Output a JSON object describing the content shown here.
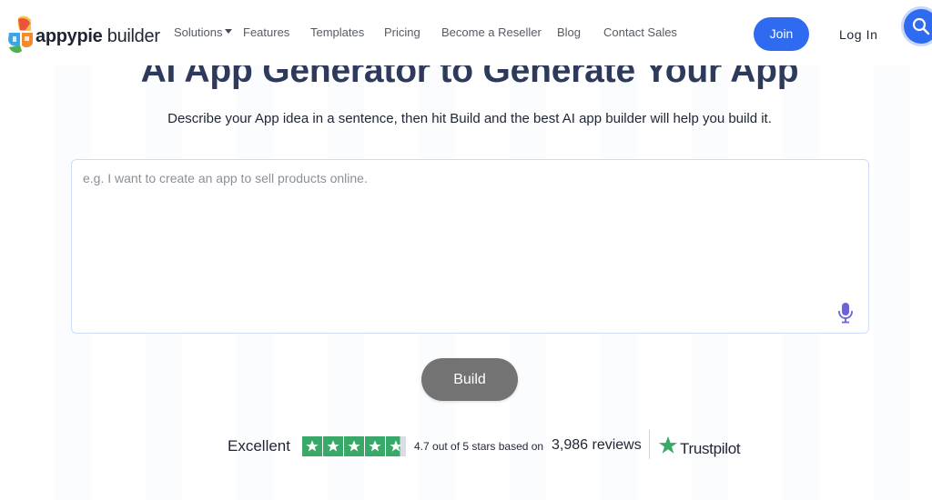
{
  "brand": {
    "name_bold": "appypie",
    "name_regular": "builder"
  },
  "nav": {
    "items": [
      {
        "label": "Solutions",
        "has_dropdown": true
      },
      {
        "label": "Features"
      },
      {
        "label": "Templates"
      },
      {
        "label": "Pricing"
      },
      {
        "label": "Become a Reseller"
      },
      {
        "label": "Blog"
      },
      {
        "label": "Contact Sales"
      }
    ],
    "join_label": "Join",
    "login_label": "Log In"
  },
  "hero": {
    "title": "AI App Generator to Generate Your App",
    "subtitle": "Describe your App idea in a sentence, then hit Build and the best AI app builder will help you build it."
  },
  "prompt": {
    "placeholder": "e.g. I want to create an app to sell products online.",
    "value": ""
  },
  "build_label": "Build",
  "rating": {
    "label": "Excellent",
    "stars": 4.7,
    "text": "4.7 out of 5 stars based on",
    "reviews": "3,986 reviews",
    "provider": "Trustpilot"
  },
  "colors": {
    "accent": "#2f6bf0",
    "title": "#2e3a5c",
    "build_button": "#737373",
    "trustpilot_green": "#3aa869"
  }
}
